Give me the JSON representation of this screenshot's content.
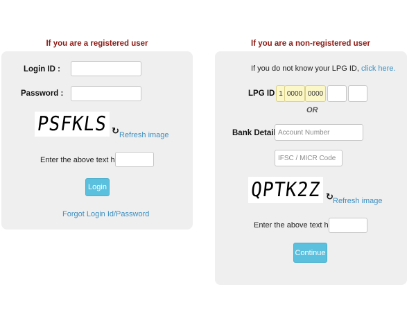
{
  "registered": {
    "heading": "If you are a registered user",
    "login_id_label": "Login ID :",
    "login_id_value": "",
    "password_label": "Password :",
    "password_value": "",
    "captcha_text": "PSFKLS",
    "refresh_label": "Refresh image",
    "captcha_prompt": "Enter the above text here:",
    "captcha_value": "",
    "login_button": "Login",
    "forgot_link": "Forgot Login Id/Password"
  },
  "nonregistered": {
    "heading": "If you are a non-registered user",
    "info_text": "If you do not know your LPG ID,",
    "info_link": "click here.",
    "lpg_label": "LPG ID :",
    "lpg_fields": [
      "1",
      "0000",
      "0000",
      "",
      ""
    ],
    "or_text": "OR",
    "bank_label": "Bank Details :",
    "account_placeholder": "Account Number",
    "ifsc_placeholder": "IFSC / MICR Code",
    "captcha_text": "QPTK2Z",
    "refresh_label": "Refresh image",
    "captcha_prompt": "Enter the above text here:",
    "captcha_value": "",
    "continue_button": "Continue"
  },
  "colors": {
    "heading": "#8b1a14",
    "panel": "#efefef",
    "link": "#3c8fc2",
    "button": "#5bc0de",
    "lpg_field_fill": "#fbf7c8"
  },
  "icons": {
    "refresh": "refresh-icon"
  }
}
